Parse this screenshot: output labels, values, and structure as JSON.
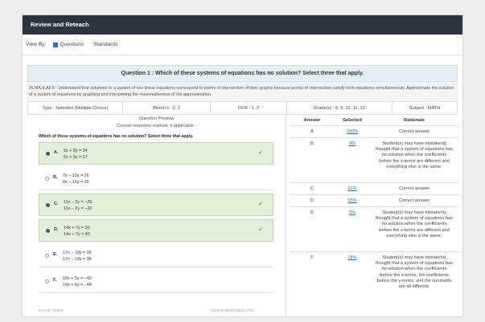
{
  "header": {
    "title": "Review and Reteach"
  },
  "viewby": {
    "label": "View By:",
    "questions": "Questions",
    "standards": "Standards"
  },
  "question": {
    "title": "Question 1 : Which of these systems of equations has no solution? Select three that apply.",
    "standard": "IN.MA.8.AF.8 : Understand that solutions to a system of two linear equations correspond to points of intersection of their graphs because points of intersection satisfy both equations simultaneously. Approximate the solution of a system of equations by graphing and interpreting the reasonableness of the approximation.",
    "type": "Type : Selected (Multiple Choice)",
    "blooms": "Bloom's : 2, 3",
    "dok": "DOK : 1, 2",
    "grades": "Grade(s) : 8, 9, 10, 11, 12",
    "subject": "Subject : MATH"
  },
  "preview": {
    "title": "Question Preview",
    "subtitle": "Correct response marked, if applicable :",
    "prompt": "Which of these systems of equations has no solution? Select three that apply.",
    "choices": [
      {
        "letter": "A.",
        "eq1": "5x + 9y = 34",
        "eq2": "5x + 9y = 27",
        "correct": true
      },
      {
        "letter": "B.",
        "eq1": "7x − 15y = 26",
        "eq2": "8x − 15y = 26",
        "correct": false
      },
      {
        "letter": "C.",
        "eq1": "11x − 2y = −25",
        "eq2": "11x − 2y = −20",
        "correct": true
      },
      {
        "letter": "D.",
        "eq1": "14x + 7y = 30",
        "eq2": "14x + 7y = 40",
        "correct": true
      },
      {
        "letter": "E.",
        "eq1": "17x − 10y = 38",
        "eq2": "17x − 12y = 38",
        "correct": false
      },
      {
        "letter": "F.",
        "eq1": "18x + 5y = −42",
        "eq2": "19x + 6y = −44",
        "correct": false
      }
    ],
    "item_id": "Item ID: 62863",
    "timestamp": "2018-04-04 06:29pm UTC"
  },
  "answers": {
    "headers": {
      "answer": "Answer",
      "selected": "Selected",
      "rationale": "Rationale"
    },
    "rows": [
      {
        "answer": "A",
        "selected": "100%",
        "rationale": "Correct answer"
      },
      {
        "answer": "B",
        "selected": "9%",
        "rationale": "Student(s) may have mistakenly thought that a system of equations has no solution when the coefficients before the x-terms are different and everything else is the same."
      },
      {
        "answer": "C",
        "selected": "91%",
        "rationale": "Correct answer"
      },
      {
        "answer": "D",
        "selected": "55%",
        "rationale": "Correct answer"
      },
      {
        "answer": "E",
        "selected": "9%",
        "rationale": "Student(s) may have mistakenly thought that a system of equations has no solution when the coefficients before the x-terms are different and everything else is the same."
      },
      {
        "answer": "F",
        "selected": "18%",
        "rationale": "Student(s) may have mistakenly thought that a system of equations has no solution when the coefficients before the x-terms, the coefficients before the y-terms, and the constants are all different."
      }
    ]
  }
}
